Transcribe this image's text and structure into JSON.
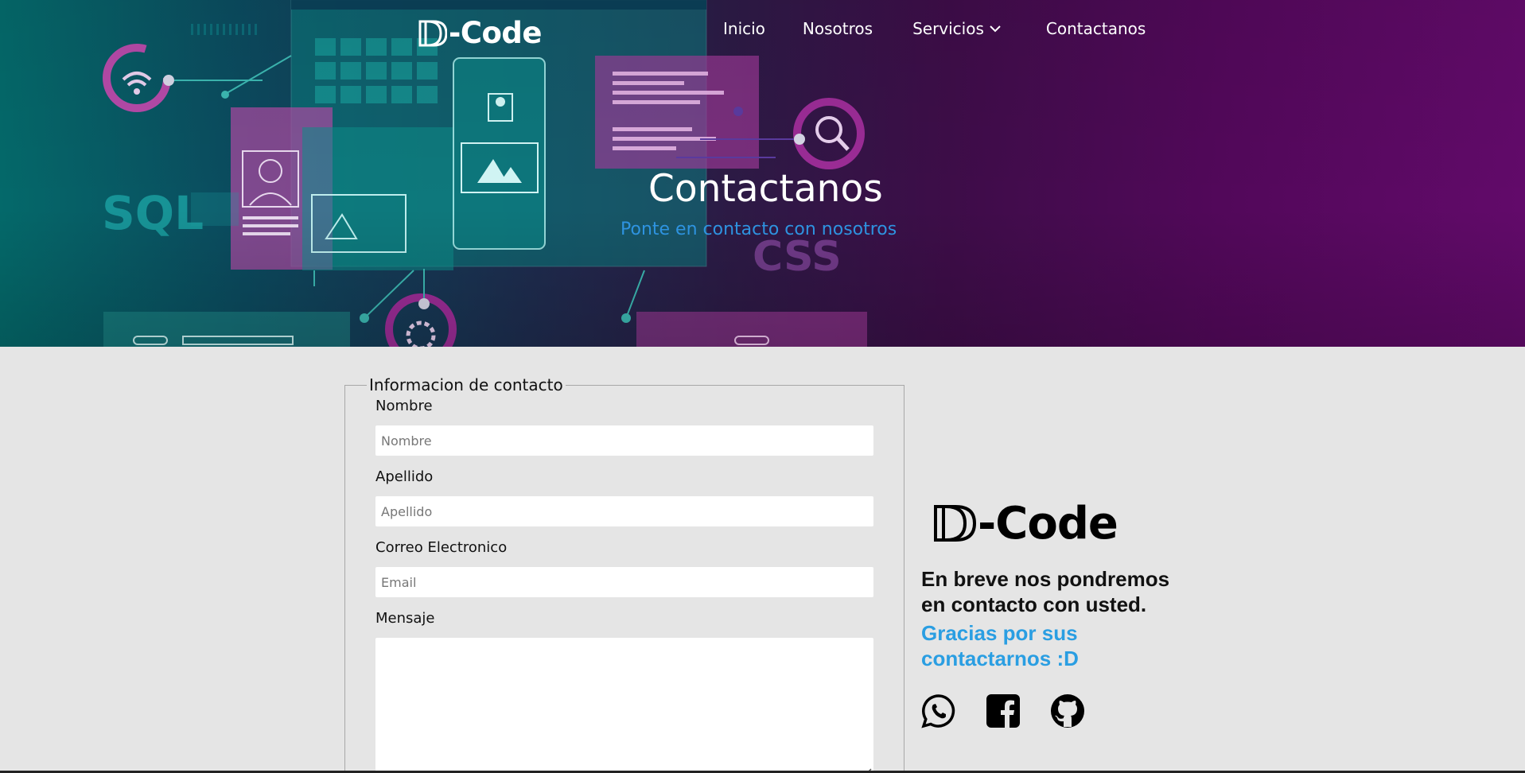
{
  "header": {
    "brand": "-Code",
    "nav": [
      {
        "label": "Inicio"
      },
      {
        "label": "Nosotros"
      },
      {
        "label": "Servicios"
      },
      {
        "label": "Contactanos"
      }
    ],
    "title": "Contactanos",
    "subtitle": "Ponte en contacto con nosotros",
    "art_labels": {
      "sql": "SQL",
      "css": "CSS"
    }
  },
  "form": {
    "legend": "Informacion de contacto",
    "fields": {
      "nombre": {
        "label": "Nombre",
        "placeholder": "Nombre",
        "value": ""
      },
      "apellido": {
        "label": "Apellido",
        "placeholder": "Apellido",
        "value": ""
      },
      "email": {
        "label": "Correo Electronico",
        "placeholder": "Email",
        "value": ""
      },
      "mensaje": {
        "label": "Mensaje",
        "value": ""
      }
    }
  },
  "side": {
    "brand": "-Code",
    "message": "En breve nos pondremos en contacto con usted.",
    "thanks": "Gracias por sus contactarnos :D",
    "social": [
      {
        "icon": "whatsapp-icon"
      },
      {
        "icon": "facebook-icon"
      },
      {
        "icon": "github-icon"
      }
    ]
  },
  "colors": {
    "accent_blue": "#2a9ee2",
    "subtitle_blue": "#2e93e0",
    "page_bg": "#e5e5e5",
    "hero_teal": "#04696a",
    "hero_purple": "#620a6a"
  }
}
